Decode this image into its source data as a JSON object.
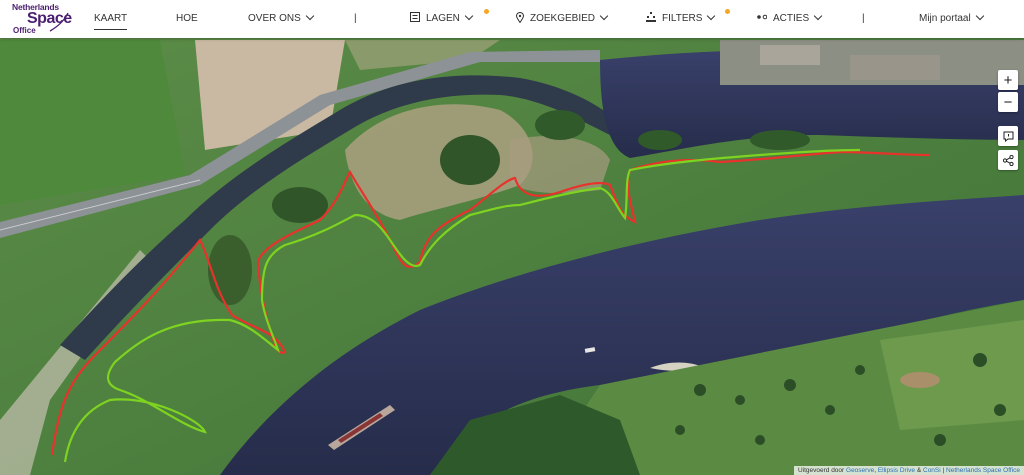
{
  "logo": {
    "line1": "Netherlands",
    "line2": "Space",
    "line3": "Office"
  },
  "nav": {
    "kaart": "KAART",
    "hoe": "HOE",
    "over_ons": "OVER ONS",
    "lagen": "LAGEN",
    "zoekgebied": "ZOEKGEBIED",
    "filters": "FILTERS",
    "acties": "ACTIES",
    "mijn_portaal": "Mijn portaal"
  },
  "separator": "|",
  "colors": {
    "brand": "#4b1f6f",
    "indicator": "#f5a623",
    "line_red": "#e8322b",
    "line_green": "#7ed321",
    "water": "#2c3555"
  },
  "map_controls": {
    "zoom_in": "+",
    "zoom_out": "−"
  },
  "icons": [
    "layers-icon",
    "location-pin-icon",
    "filter-icon",
    "actions-icon",
    "chevron-down-icon",
    "comment-icon",
    "share-icon"
  ],
  "attribution": {
    "prefix": "Uitgevoerd door",
    "providers": [
      "Geoserve",
      "Ellipsis Drive",
      "ConSi"
    ],
    "amp": "&",
    "sep": "|",
    "owner": "Netherlands Space Office"
  }
}
